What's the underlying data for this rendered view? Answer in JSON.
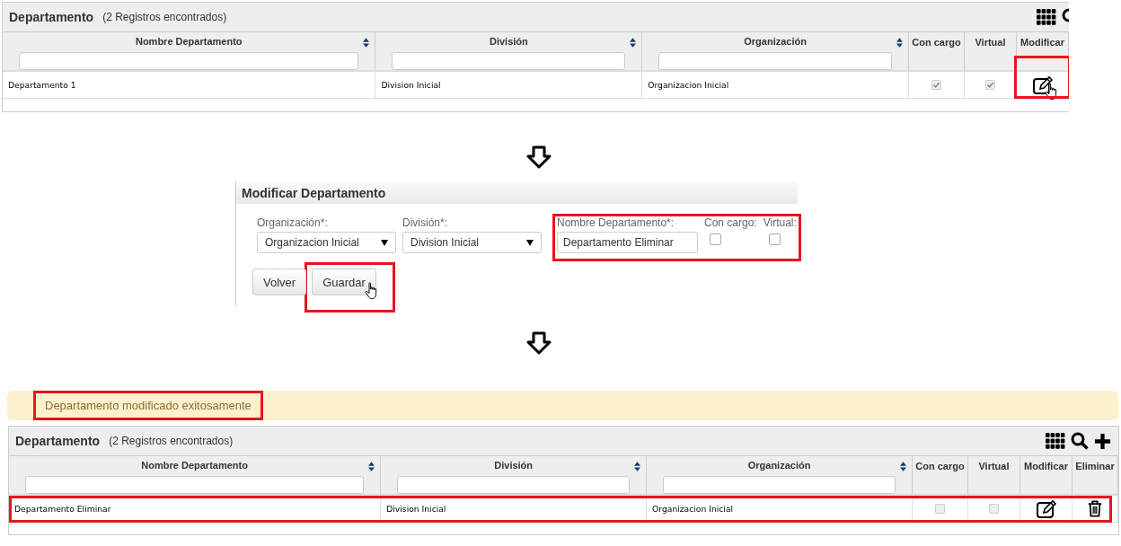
{
  "list_before": {
    "title": "Departamento",
    "count": "(2 Registros encontrados)",
    "toolbar": [
      {
        "kind": "grid"
      },
      {
        "kind": "search"
      }
    ],
    "columns": [
      {
        "label": "Nombre Departamento",
        "kind": "text",
        "sortable": true,
        "highlighted": false
      },
      {
        "label": "División",
        "kind": "text",
        "sortable": true,
        "highlighted": false
      },
      {
        "label": "Organización",
        "kind": "text",
        "sortable": true,
        "highlighted": false
      },
      {
        "label": "Con cargo",
        "kind": "check",
        "sortable": false,
        "highlighted": false
      },
      {
        "label": "Virtual",
        "kind": "check",
        "sortable": false,
        "highlighted": false
      },
      {
        "label": "Modificar",
        "kind": "edit",
        "sortable": false,
        "highlighted": true
      }
    ],
    "rows": [
      {
        "texts": [
          "Departamento 1",
          "Division Inicial",
          "Organizacion Inicial"
        ],
        "checks": [
          {
            "checked": true
          },
          {
            "checked": true
          }
        ],
        "hovered": true,
        "highlighted": false
      }
    ]
  },
  "form": {
    "title": "Modificar Departamento",
    "groups": [
      {
        "highlighted": false,
        "fields": [
          {
            "kind": "select",
            "label": "Organización*:",
            "value": "Organizacion Inicial"
          },
          {
            "kind": "select",
            "label": "División*:",
            "value": "Division Inicial"
          }
        ]
      },
      {
        "highlighted": true,
        "fields": [
          {
            "kind": "text",
            "label": "Nombre Departamento*:",
            "value": "Departamento Eliminar"
          },
          {
            "kind": "check",
            "label": "Con cargo:",
            "checked": false
          },
          {
            "kind": "check",
            "label": "Virtual:",
            "checked": false
          }
        ]
      }
    ],
    "buttons": [
      {
        "label": "Volver",
        "highlighted": false,
        "hovered": false
      },
      {
        "label": "Guardar",
        "highlighted": true,
        "hovered": true
      }
    ]
  },
  "alert": {
    "text": "Departamento modificado exitosamente",
    "highlighted": true
  },
  "list_after": {
    "title": "Departamento",
    "count": "(2 Registros encontrados)",
    "toolbar": [
      {
        "kind": "grid"
      },
      {
        "kind": "search"
      },
      {
        "kind": "add"
      }
    ],
    "columns": [
      {
        "label": "Nombre Departamento",
        "kind": "text",
        "sortable": true,
        "highlighted": false
      },
      {
        "label": "División",
        "kind": "text",
        "sortable": true,
        "highlighted": false
      },
      {
        "label": "Organización",
        "kind": "text",
        "sortable": true,
        "highlighted": false
      },
      {
        "label": "Con cargo",
        "kind": "check",
        "sortable": false,
        "highlighted": false
      },
      {
        "label": "Virtual",
        "kind": "check",
        "sortable": false,
        "highlighted": false
      },
      {
        "label": "Modificar",
        "kind": "edit",
        "sortable": false,
        "highlighted": false
      },
      {
        "label": "Eliminar",
        "kind": "delete",
        "sortable": false,
        "highlighted": false
      }
    ],
    "rows": [
      {
        "texts": [
          "Departamento Eliminar",
          "Division Inicial",
          "Organizacion Inicial"
        ],
        "checks": [
          {
            "checked": false
          },
          {
            "checked": false
          }
        ],
        "hovered": false,
        "highlighted": true
      }
    ]
  }
}
